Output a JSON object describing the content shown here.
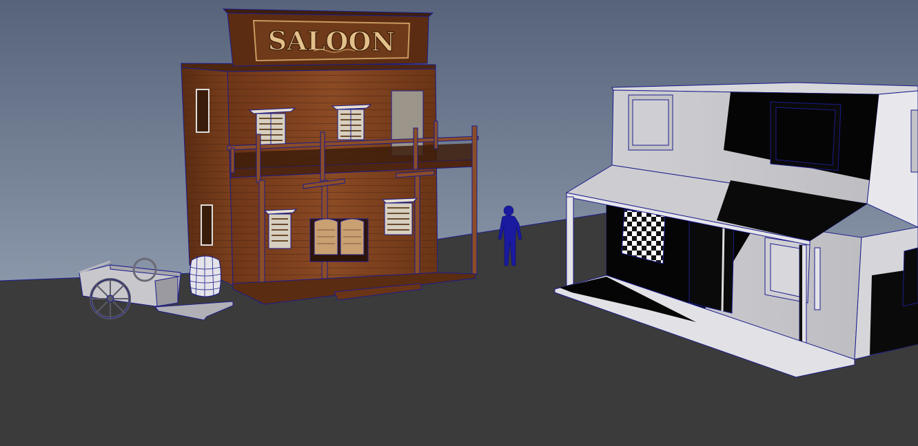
{
  "viewport": {
    "colors": {
      "sky_top": "#56637a",
      "sky_bottom": "#a7b3c4",
      "ground": "#3b3b3b",
      "wireframe": "#1c1c8c",
      "wood_dark": "#5a2d14",
      "wood_mid": "#7a3f1d",
      "wood_light": "#9a5a2e",
      "sign_gold": "#d9b37a",
      "clay": "#c9c9cd",
      "figure": "#1a1aa0"
    }
  },
  "saloon": {
    "sign_text": "SALOON"
  }
}
